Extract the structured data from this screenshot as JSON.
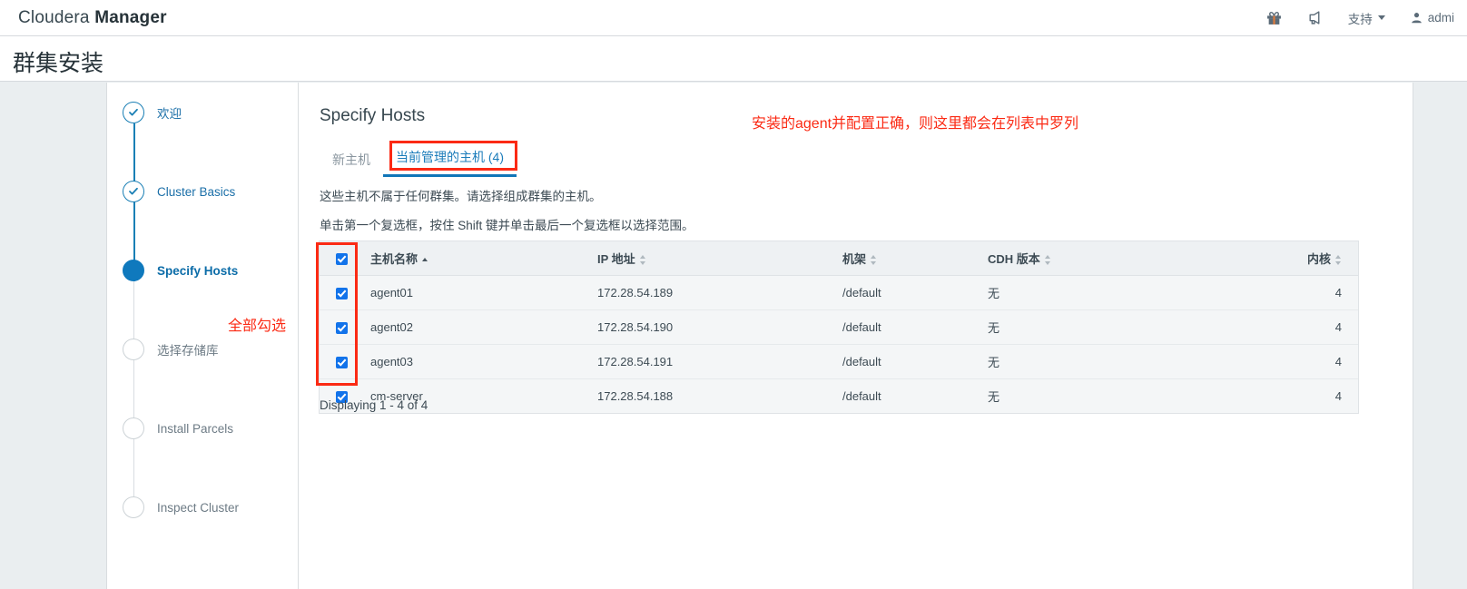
{
  "navbar": {
    "brand_prefix": "Cloudera ",
    "brand_bold": "Manager",
    "gift_icon": "gift-icon",
    "announcement_icon": "announcement-icon",
    "support_label": "支持",
    "user_label": "admi"
  },
  "page": {
    "title": "群集安装"
  },
  "wizard": {
    "steps": [
      {
        "label": "欢迎",
        "state": "done"
      },
      {
        "label": "Cluster Basics",
        "state": "done"
      },
      {
        "label": "Specify Hosts",
        "state": "active"
      },
      {
        "label": "选择存储库",
        "state": "todo"
      },
      {
        "label": "Install Parcels",
        "state": "todo"
      },
      {
        "label": "Inspect Cluster",
        "state": "todo"
      }
    ]
  },
  "main": {
    "section_title": "Specify Hosts",
    "tabs": [
      {
        "label": "新主机",
        "active": false
      },
      {
        "label": "当前管理的主机 (4)",
        "active": true
      }
    ],
    "notes": [
      "这些主机不属于任何群集。请选择组成群集的主机。",
      "单击第一个复选框，按住 Shift 键并单击最后一个复选框以选择范围。"
    ],
    "table": {
      "headers": {
        "select_all": "",
        "hostname": "主机名称",
        "ip": "IP 地址",
        "rack": "机架",
        "cdh_version": "CDH 版本",
        "cores": "内核"
      },
      "sort_column": "主机名称",
      "sort_direction": "asc",
      "select_all_checked": true,
      "rows": [
        {
          "checked": true,
          "hostname": "agent01",
          "ip": "172.28.54.189",
          "rack": "/default",
          "cdh_version": "无",
          "cores": "4"
        },
        {
          "checked": true,
          "hostname": "agent02",
          "ip": "172.28.54.190",
          "rack": "/default",
          "cdh_version": "无",
          "cores": "4"
        },
        {
          "checked": true,
          "hostname": "agent03",
          "ip": "172.28.54.191",
          "rack": "/default",
          "cdh_version": "无",
          "cores": "4"
        },
        {
          "checked": true,
          "hostname": "cm-server",
          "ip": "172.28.54.188",
          "rack": "/default",
          "cdh_version": "无",
          "cores": "4"
        }
      ]
    },
    "displaying": "Displaying 1 - 4 of 4"
  },
  "annotations": {
    "top_note": "安装的agent并配置正确，则这里都会在列表中罗列",
    "checkbox_note": "全部勾选",
    "color": "#fb2a14"
  }
}
